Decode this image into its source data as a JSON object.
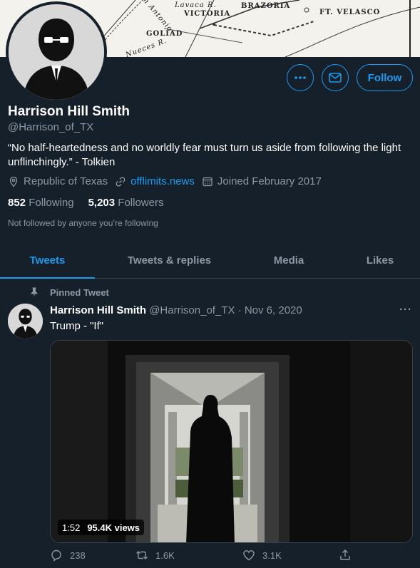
{
  "banner": {
    "map_labels": [
      "Lavaca R.",
      "VICTORIA",
      "BRAZORIA",
      "FT. VELASCO",
      "San Antonio",
      "GOLIAD",
      "Nueces R."
    ]
  },
  "profile": {
    "name": "Harrison Hill Smith",
    "handle": "@Harrison_of_TX",
    "bio": "“No half-heartedness and no worldly fear must turn us aside from following the light unflinchingly.” - Tolkien",
    "location": "Republic of Texas",
    "website": "offlimits.news",
    "joined": "Joined February 2017",
    "following_count": "852",
    "following_label": "Following",
    "followers_count": "5,203",
    "followers_label": "Followers",
    "not_followed": "Not followed by anyone you’re following"
  },
  "buttons": {
    "more": "•••",
    "follow": "Follow"
  },
  "tabs": [
    {
      "label": "Tweets",
      "active": true
    },
    {
      "label": "Tweets & replies",
      "active": false
    },
    {
      "label": "Media",
      "active": false
    },
    {
      "label": "Likes",
      "active": false
    }
  ],
  "tweet": {
    "pinned_label": "Pinned Tweet",
    "author_name": "Harrison Hill Smith",
    "author_handle": "@Harrison_of_TX",
    "separator": "·",
    "date": "Nov 6, 2020",
    "more": "···",
    "text": "Trump - \"If\"",
    "video_duration": "1:52",
    "video_views": "95.4K views",
    "replies": "238",
    "retweets": "1.6K",
    "likes": "3.1K"
  },
  "colors": {
    "background": "#15202b",
    "accent": "#1d9bf0",
    "muted": "#8b98a5",
    "border": "#38444d"
  },
  "icons": [
    "more-icon",
    "mail-icon",
    "location-icon",
    "link-icon",
    "calendar-icon",
    "pin-icon",
    "reply-icon",
    "retweet-icon",
    "like-icon",
    "share-icon"
  ]
}
